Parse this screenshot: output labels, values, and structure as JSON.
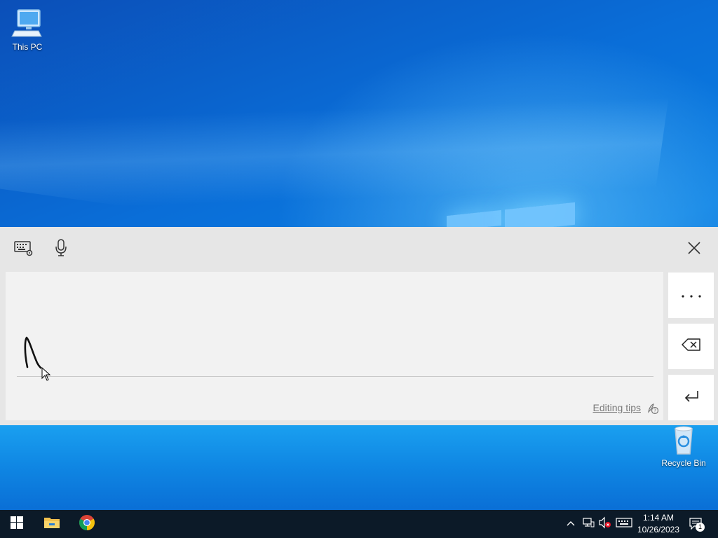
{
  "desktop": {
    "icons": [
      {
        "label": "This PC",
        "icon": "this-pc-icon"
      },
      {
        "label": "Recycle Bin",
        "icon": "recycle-bin-icon"
      }
    ]
  },
  "handwriting_panel": {
    "toolbar": {
      "keyboard_settings_icon": "keyboard-settings-icon",
      "microphone_icon": "microphone-icon",
      "close_icon": "close-icon"
    },
    "editing_tips": "Editing tips",
    "side_buttons": [
      {
        "name": "more-options",
        "icon": "ellipsis-icon"
      },
      {
        "name": "backspace",
        "icon": "backspace-icon"
      },
      {
        "name": "enter",
        "icon": "enter-icon"
      }
    ]
  },
  "taskbar": {
    "pinned": [
      "start-icon",
      "file-explorer-icon",
      "chrome-icon"
    ],
    "tray": {
      "time": "1:14 AM",
      "date": "10/26/2023",
      "notification_count": "1"
    }
  },
  "colors": {
    "taskbar": "#0c1a28",
    "panel": "#e6e6e6",
    "canvas": "#f2f2f2",
    "desktop_blue": "#0a6fd6"
  }
}
